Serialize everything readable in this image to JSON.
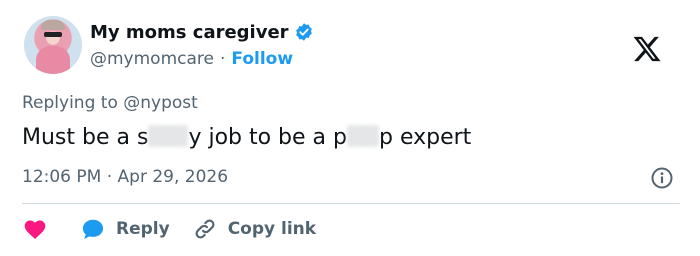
{
  "author": {
    "display_name": "My moms caregiver",
    "handle": "@mymomcare",
    "separator": "·",
    "follow_label": "Follow",
    "verified": true,
    "avatar": "avatar-photo"
  },
  "reply_context": {
    "prefix": "Replying to",
    "target": "@nypost"
  },
  "tweet": {
    "parts": [
      "Must be a s",
      "y job to be a p",
      "p expert"
    ]
  },
  "meta": {
    "time": "12:06 PM",
    "separator": "·",
    "date": "Apr 29, 2026"
  },
  "actions": {
    "like_label": "",
    "reply_label": "Reply",
    "copy_label": "Copy link"
  },
  "icons": [
    "verified-badge-icon",
    "x-logo-icon",
    "info-icon",
    "heart-icon",
    "reply-bubble-icon",
    "link-icon"
  ],
  "colors": {
    "accent": "#1d9bf0",
    "heart": "#f91880",
    "text": "#0f1419",
    "muted": "#536471"
  }
}
